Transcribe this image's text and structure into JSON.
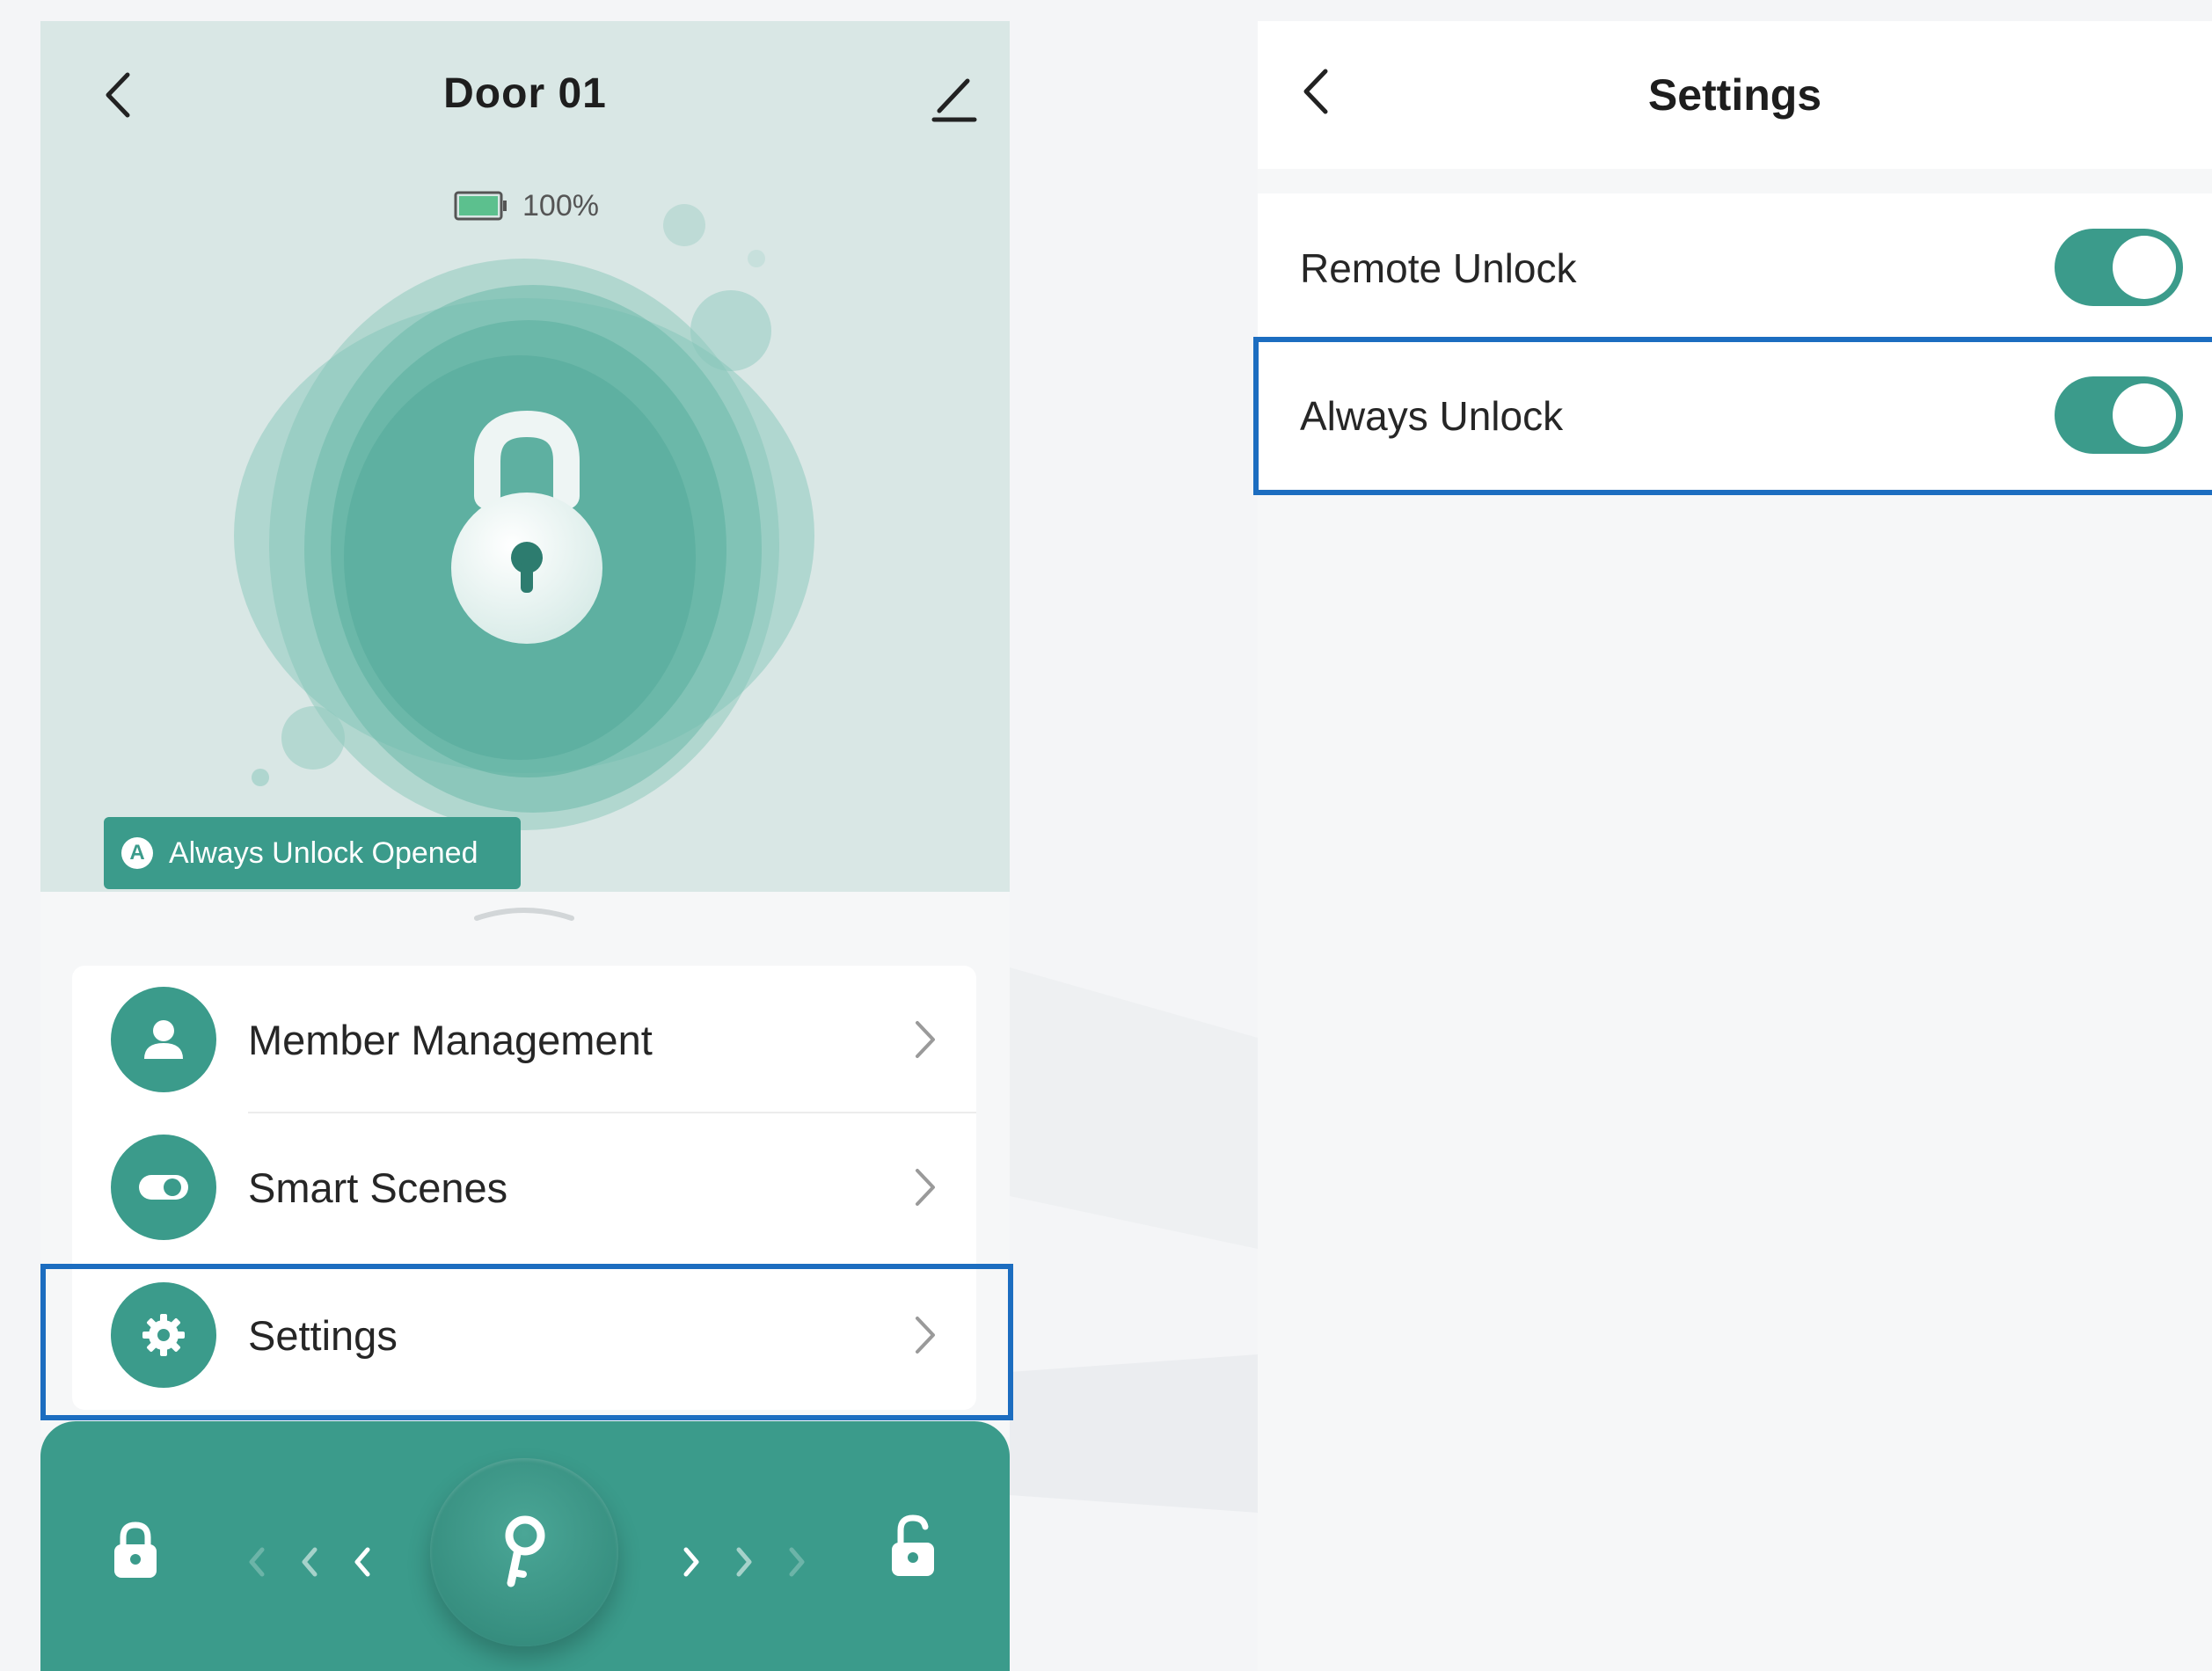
{
  "left_screen": {
    "header": {
      "title": "Door 01",
      "back_icon": "chevron-left-icon",
      "edit_icon": "pencil-icon"
    },
    "battery": {
      "level_text": "100%",
      "level": 1.0,
      "icon": "battery-icon"
    },
    "lock": {
      "icon": "padlock-icon"
    },
    "status_badge": {
      "icon_letter": "A",
      "text": "Always Unlock Opened"
    },
    "menu": {
      "items": [
        {
          "label": "Member Management",
          "icon": "person-icon"
        },
        {
          "label": "Smart Scenes",
          "icon": "toggle-scene-icon"
        },
        {
          "label": "Settings",
          "icon": "gear-icon"
        }
      ]
    },
    "action_bar": {
      "lock_icon": "lock-closed-icon",
      "key_icon": "key-icon",
      "unlock_icon": "lock-open-icon"
    }
  },
  "right_screen": {
    "header": {
      "title": "Settings",
      "back_icon": "chevron-left-icon"
    },
    "rows": [
      {
        "label": "Remote Unlock",
        "enabled": true
      },
      {
        "label": "Always Unlock",
        "enabled": true
      }
    ]
  },
  "colors": {
    "accent": "#3b9b8b",
    "hero_background": "#d9e7e5",
    "highlight_border": "#1c6dc0",
    "page_background": "#f4f5f7"
  }
}
